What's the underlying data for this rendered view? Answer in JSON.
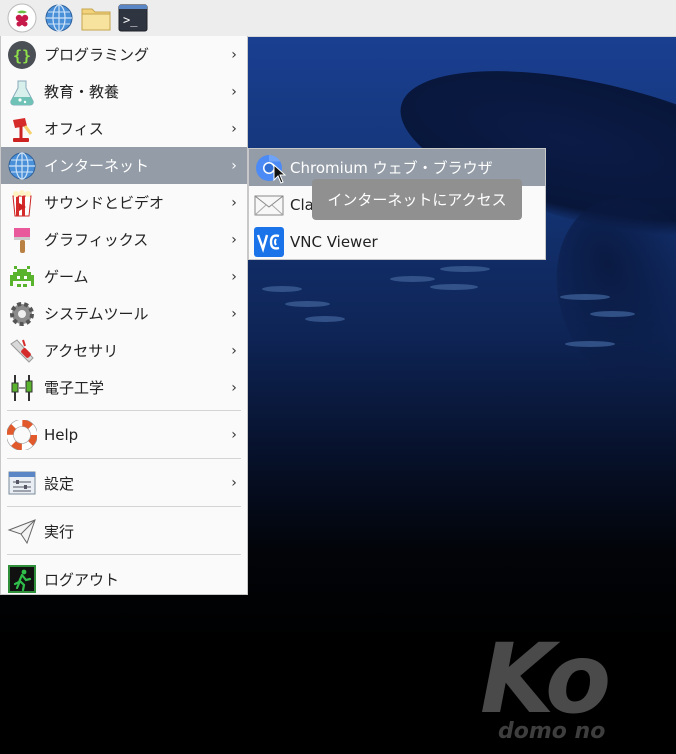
{
  "taskbar": {
    "icons": [
      "raspberry-icon",
      "web-browser-icon",
      "file-manager-icon",
      "terminal-icon"
    ],
    "terminal_glyph": ">_"
  },
  "menu": {
    "items": [
      {
        "label": "プログラミング",
        "icon": "programming-icon"
      },
      {
        "label": "教育・教養",
        "icon": "education-icon"
      },
      {
        "label": "オフィス",
        "icon": "office-icon"
      },
      {
        "label": "インターネット",
        "icon": "internet-icon"
      },
      {
        "label": "サウンドとビデオ",
        "icon": "sound-video-icon"
      },
      {
        "label": "グラフィックス",
        "icon": "graphics-icon"
      },
      {
        "label": "ゲーム",
        "icon": "games-icon"
      },
      {
        "label": "システムツール",
        "icon": "system-tools-icon"
      },
      {
        "label": "アクセサリ",
        "icon": "accessories-icon"
      },
      {
        "label": "電子工学",
        "icon": "electronics-icon"
      },
      {
        "label": "Help",
        "icon": "help-icon"
      },
      {
        "label": "設定",
        "icon": "preferences-icon"
      },
      {
        "label": "実行",
        "icon": "run-icon"
      },
      {
        "label": "ログアウト",
        "icon": "logout-icon"
      }
    ],
    "arrow": "›"
  },
  "submenu": {
    "items": [
      {
        "label": "Chromium ウェブ・ブラウザ",
        "icon": "chromium-icon"
      },
      {
        "label": "Claws Mail",
        "icon": "mail-icon"
      },
      {
        "label": "VNC Viewer",
        "icon": "vnc-viewer-icon"
      }
    ]
  },
  "tooltip": {
    "text": "インターネットにアクセス"
  },
  "wallpaper": {
    "logo_big": "Ko",
    "logo_small": "domo no"
  },
  "colors": {
    "highlight": "#939ca7",
    "menu_bg": "#fafafa",
    "tooltip_bg": "#909090"
  }
}
